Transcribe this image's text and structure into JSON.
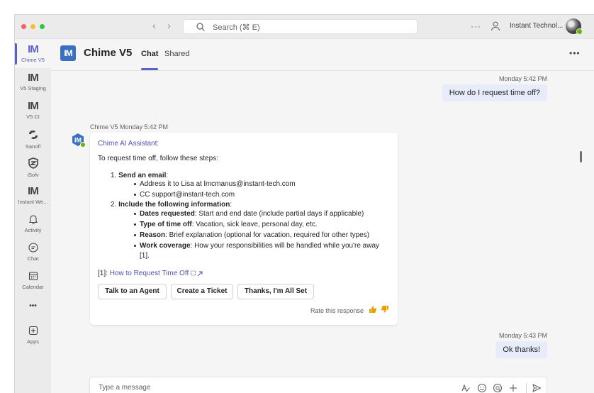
{
  "titlebar": {
    "search_placeholder": "Search (⌘ E)",
    "org_name": "Instant Technol..."
  },
  "rail": {
    "items": [
      {
        "label": "Chime V5",
        "glyph": "IM"
      },
      {
        "label": "V5 Staging",
        "glyph": "IM"
      },
      {
        "label": "V5 CI",
        "glyph": "IM"
      },
      {
        "label": "Sanofi",
        "glyph": ""
      },
      {
        "label": "iSolv",
        "glyph": ""
      },
      {
        "label": "Instant We...",
        "glyph": "IM"
      },
      {
        "label": "Activity",
        "glyph": ""
      },
      {
        "label": "Chat",
        "glyph": ""
      },
      {
        "label": "Calendar",
        "glyph": ""
      },
      {
        "label": "",
        "glyph": "•••"
      },
      {
        "label": "Apps",
        "glyph": ""
      }
    ]
  },
  "header": {
    "logo_text": "IM",
    "title": "Chime V5",
    "tabs": [
      {
        "label": "Chat"
      },
      {
        "label": "Shared"
      }
    ],
    "more": "•••"
  },
  "messages": {
    "first_time": "Monday 5:42 PM",
    "first_text": "How do I request time off?",
    "bot_meta": "Chime V5  Monday 5:42 PM",
    "bot_avatar_text": "IM",
    "bot_name": "Chime AI Assistant:",
    "intro": "To request time off, follow these steps:",
    "step1_num": "1.",
    "step1_title": "Send an email",
    "step1_b1": "Address it to Lisa at lmcmanus@instant-tech.com",
    "step1_b2": "CC support@instant-tech.com",
    "step2_num": "2.",
    "step2_title": "Include the following information",
    "d1_label": "Dates requested",
    "d1_text": ": Start and end date (include partial days if applicable)",
    "d2_label": "Type of time off",
    "d2_text": ": Vacation, sick leave, personal day, etc.",
    "d3_label": "Reason",
    "d3_text": ": Brief explanation (optional for vacation, required for other types)",
    "d4_label": "Work coverage",
    "d4_text": ": How your responsibilities will be handled while you're away",
    "d4_cont": "[1].",
    "ref_prefix": "[1]: ",
    "ref_link": "How to Request Time Off",
    "buttons": [
      "Talk to an Agent",
      "Create a Ticket",
      "Thanks, I'm All Set"
    ],
    "rate_text": "Rate this response",
    "second_time": "Monday 5:43 PM",
    "second_text": "Ok thanks!"
  },
  "compose": {
    "placeholder": "Type a message"
  },
  "colors": {
    "accent": "#5b5fc7",
    "self_bubble": "#e8ebfa",
    "presence": "#6bb700",
    "thumb": "#e8a100"
  }
}
